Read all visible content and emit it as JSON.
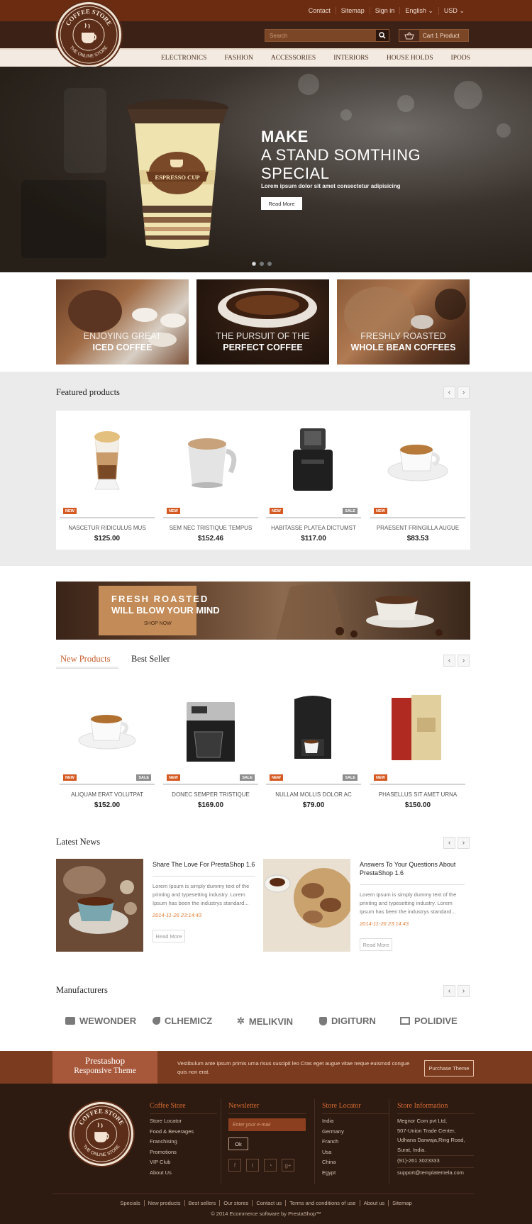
{
  "topbar": {
    "links": [
      "Contact",
      "Sitemap",
      "Sign in"
    ],
    "language": "English",
    "currency": "USD"
  },
  "logo": {
    "top_text": "COFFEE STORE",
    "bottom_text": "THE ONLINE STORE"
  },
  "search": {
    "placeholder": "Search"
  },
  "cart": {
    "label": "Cart 1 Product"
  },
  "nav": {
    "items": [
      "ELECTRONICS",
      "FASHION",
      "ACCESSORIES",
      "INTERIORS",
      "HOUSE HOLDS",
      "IPODS"
    ]
  },
  "hero": {
    "line1": "MAKE",
    "line2": "A STAND SOMTHING",
    "line3": "SPECIAL",
    "subtitle": "Lorem ipsum dolor sit amet consectetur adipisicing",
    "button": "Read More",
    "cup_label": "ESPRESSO CUP"
  },
  "promos": [
    {
      "l1": "ENJOYING GREAT",
      "l2": "ICED COFFEE"
    },
    {
      "l1": "THE PURSUIT OF THE",
      "l2": "PERFECT COFFEE"
    },
    {
      "l1": "FRESHLY ROASTED",
      "l2": "WHOLE BEAN COFFEES"
    }
  ],
  "featured": {
    "title": "Featured products",
    "products": [
      {
        "name": "NASCETUR RIDICULUS MUS",
        "price": "$125.00",
        "new": "NEW",
        "sale": ""
      },
      {
        "name": "SEM NEC TRISTIQUE TEMPUS",
        "price": "$152.46",
        "new": "NEW",
        "sale": ""
      },
      {
        "name": "HABITASSE PLATEA DICTUMST",
        "price": "$117.00",
        "new": "NEW",
        "sale": "SALE"
      },
      {
        "name": "PRAESENT FRINGILLA AUGUE",
        "price": "$83.53",
        "new": "NEW",
        "sale": ""
      }
    ]
  },
  "banner": {
    "line1": "FRESH ROASTED",
    "line2": "WILL BLOW YOUR MIND",
    "line3": "SHOP NOW"
  },
  "tabs": {
    "new": "New Products",
    "best": "Best Seller"
  },
  "new_products": [
    {
      "name": "ALIQUAM ERAT VOLUTPAT",
      "price": "$152.00",
      "new": "NEW",
      "sale": "SALE"
    },
    {
      "name": "DONEC SEMPER TRISTIQUE",
      "price": "$169.00",
      "new": "NEW",
      "sale": "SALE"
    },
    {
      "name": "NULLAM MOLLIS DOLOR AC",
      "price": "$79.00",
      "new": "NEW",
      "sale": "SALE"
    },
    {
      "name": "PHASELLUS SIT AMET URNA",
      "price": "$150.00",
      "new": "NEW",
      "sale": ""
    }
  ],
  "news": {
    "title": "Latest News",
    "items": [
      {
        "title": "Share The Love For PrestaShop 1.6",
        "body": "Lorem Ipsum is simply dummy text of the printing and typesetting industry. Lorem Ipsum has been the industrys standard...",
        "date": "2014-11-26 23:14:43",
        "button": "Read More"
      },
      {
        "title": "Answers To Your Questions About PrestaShop 1.6",
        "body": "Lorem Ipsum is simply dummy text of the printing and typesetting industry. Lorem Ipsum has been the industrys standard...",
        "date": "2014-11-26 23:14:43",
        "button": "Read More"
      }
    ]
  },
  "manufacturers": {
    "title": "Manufacturers",
    "items": [
      "WEWONDER",
      "CLHEMICZ",
      "MELIKVIN",
      "DIGITURN",
      "POLIDIVE"
    ]
  },
  "band": {
    "title1": "Prestashop",
    "title2": "Responsive Theme",
    "text": "Vestibulum ante ipsum primis urna risus suscipit leo Cras eget augue vitae neque euismod congue quis non erat.",
    "button": "Purchase Theme"
  },
  "footer": {
    "store": {
      "title": "Coffee Store",
      "items": [
        "Store Locator",
        "Food & Beverages",
        "Franchising",
        "Promotions",
        "VIP Club",
        "About Us"
      ]
    },
    "newsletter": {
      "title": "Newsletter",
      "placeholder": "Enter your e-mail",
      "button": "Ok"
    },
    "locator": {
      "title": "Store Locator",
      "items": [
        "India",
        "Germany",
        "Franch",
        "Usa",
        "China",
        "Egypt"
      ]
    },
    "info": {
      "title": "Store Information",
      "lines": [
        "Megnor Com pvt Ltd,",
        "507-Union Trade Center,",
        "Udhana Darwaja,Ring Road,",
        "Surat, India."
      ],
      "phone": "(91)-261 3023333",
      "email": "support@templatemela.com"
    },
    "links": [
      "Specials",
      "New products",
      "Best sellers",
      "Our stores",
      "Contact us",
      "Terms and conditions of use",
      "About us",
      "Sitemap"
    ],
    "copyright": "© 2014 Ecommerce software by PrestaShop™"
  }
}
